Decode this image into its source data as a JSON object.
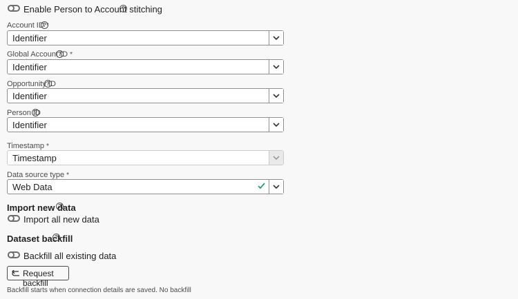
{
  "stitching": {
    "label": "Enable Person to Account stitching"
  },
  "fields": [
    {
      "label": "Account ID",
      "required": "*",
      "value": "Identifier"
    },
    {
      "label": "Global Account ID",
      "required": "*",
      "value": "Identifier"
    },
    {
      "label": "Opportunity ID",
      "value": "Identifier"
    },
    {
      "label": "Person ID",
      "value": "Identifier"
    },
    {
      "label": "Timestamp",
      "required": "*",
      "value": "Timestamp"
    },
    {
      "label": "Data source type",
      "required": "*",
      "value": "Web Data"
    }
  ],
  "import_new_data": {
    "title": "Import new data",
    "toggle_label": "Import all new data"
  },
  "dataset_backfill": {
    "title": "Dataset backfill",
    "toggle_label": "Backfill all existing data",
    "button_label": "Request backfill",
    "note": "Backfill starts when connection details are saved. No backfill"
  },
  "colors": {
    "valid_check": "#2d9d78"
  }
}
